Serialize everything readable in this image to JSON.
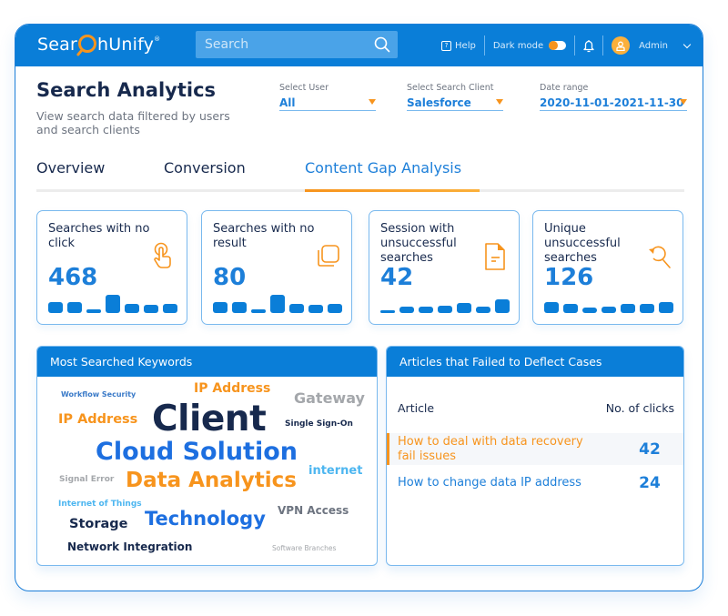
{
  "header": {
    "logo_text_pre": "Sear",
    "logo_text_post": "hUnify",
    "logo_mark": "®",
    "search_placeholder": "Search",
    "help_label": "Help",
    "dark_mode_label": "Dark mode",
    "dark_mode_on": false,
    "user_name": "Admin"
  },
  "page": {
    "title": "Search Analytics",
    "subtitle": "View search data filtered by users and search clients"
  },
  "filters": [
    {
      "label": "Select User",
      "value": "All"
    },
    {
      "label": "Select Search Client",
      "value": "Salesforce"
    },
    {
      "label": "Date range",
      "value": "2020-11-01-2021-11-30"
    }
  ],
  "tabs": [
    {
      "label": "Overview",
      "active": false
    },
    {
      "label": "Conversion",
      "active": false
    },
    {
      "label": "Content Gap Analysis",
      "active": true
    }
  ],
  "cards": [
    {
      "title": "Searches with no click",
      "value": "468",
      "icon": "tap-finger-icon",
      "spark": [
        0.55,
        0.55,
        0.2,
        0.9,
        0.45,
        0.4,
        0.45
      ]
    },
    {
      "title": "Searches with no result",
      "value": "80",
      "icon": "copy-squares-icon",
      "spark": [
        0.55,
        0.55,
        0.2,
        0.9,
        0.45,
        0.4,
        0.45
      ]
    },
    {
      "title": "Session with unsuccessful searches",
      "value": "42",
      "icon": "document-icon",
      "spark": [
        0.12,
        0.3,
        0.3,
        0.35,
        0.5,
        0.3,
        0.7
      ]
    },
    {
      "title": "Unique unsuccessful searches",
      "value": "126",
      "icon": "search-undo-icon",
      "spark": [
        0.55,
        0.45,
        0.25,
        0.3,
        0.45,
        0.45,
        0.55
      ]
    }
  ],
  "keywords_panel": {
    "title": "Most Searched Keywords",
    "keywords": [
      {
        "text": "Workflow Security",
        "color": "#3a7ac8"
      },
      {
        "text": "IP Address",
        "color": "#f7941d"
      },
      {
        "text": "Gateway",
        "color": "#a4a7ab"
      },
      {
        "text": "IP Address",
        "color": "#f7941d"
      },
      {
        "text": "Client",
        "color": "#17294d"
      },
      {
        "text": "Single Sign-On",
        "color": "#17294d"
      },
      {
        "text": "Cloud Solution",
        "color": "#1d6fe0"
      },
      {
        "text": "internet",
        "color": "#4db6f0"
      },
      {
        "text": "Signal Error",
        "color": "#a4a7ab"
      },
      {
        "text": "Data Analytics",
        "color": "#f7941d"
      },
      {
        "text": "Internet of Things",
        "color": "#4db6f0"
      },
      {
        "text": "VPN Access",
        "color": "#6d7480"
      },
      {
        "text": "Storage",
        "color": "#17294d"
      },
      {
        "text": "Technology",
        "color": "#1d6fe0"
      },
      {
        "text": "Network Integration",
        "color": "#17294d"
      },
      {
        "text": "Software Branches",
        "color": "#a4a7ab"
      }
    ]
  },
  "articles_panel": {
    "title": "Articles that Failed to Deflect Cases",
    "col_article": "Article",
    "col_clicks": "No. of clicks",
    "rows": [
      {
        "article": "How to deal with data recovery fail issues",
        "clicks": "42",
        "highlighted": true
      },
      {
        "article": "How to change data IP address",
        "clicks": "24",
        "highlighted": false
      }
    ]
  },
  "colors": {
    "primary": "#0a7ed8",
    "accent": "#f7941d",
    "dark_text": "#17294d"
  }
}
